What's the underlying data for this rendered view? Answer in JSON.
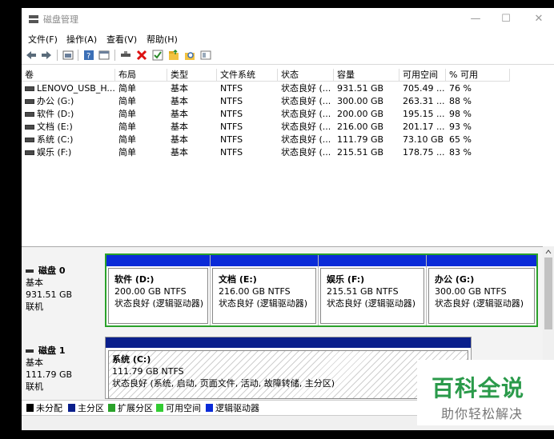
{
  "window": {
    "title": "磁盘管理",
    "minimize": "—",
    "maximize": "☐",
    "close": "✕"
  },
  "menu": [
    "文件(F)",
    "操作(A)",
    "查看(V)",
    "帮助(H)"
  ],
  "columns": [
    "卷",
    "布局",
    "类型",
    "文件系统",
    "状态",
    "容量",
    "可用空间",
    "% 可用"
  ],
  "volumes": [
    [
      "LENOVO_USB_H...",
      "简单",
      "基本",
      "NTFS",
      "状态良好 (...",
      "931.51 GB",
      "705.49 ...",
      "76 %"
    ],
    [
      "办公 (G:)",
      "简单",
      "基本",
      "NTFS",
      "状态良好 (...",
      "300.00 GB",
      "263.31 ...",
      "88 %"
    ],
    [
      "软件 (D:)",
      "简单",
      "基本",
      "NTFS",
      "状态良好 (...",
      "200.00 GB",
      "195.15 ...",
      "98 %"
    ],
    [
      "文档 (E:)",
      "简单",
      "基本",
      "NTFS",
      "状态良好 (...",
      "216.00 GB",
      "201.17 ...",
      "93 %"
    ],
    [
      "系统 (C:)",
      "简单",
      "基本",
      "NTFS",
      "状态良好 (...",
      "111.79 GB",
      "73.10 GB",
      "65 %"
    ],
    [
      "娱乐 (F:)",
      "简单",
      "基本",
      "NTFS",
      "状态良好 (...",
      "215.51 GB",
      "178.75 ...",
      "83 %"
    ]
  ],
  "disk0": {
    "name": "磁盘 0",
    "type": "基本",
    "size": "931.51 GB",
    "status": "联机",
    "partitions": [
      {
        "name": "软件  (D:)",
        "size": "200.00 GB NTFS",
        "status": "状态良好 (逻辑驱动器)"
      },
      {
        "name": "文档  (E:)",
        "size": "216.00 GB NTFS",
        "status": "状态良好 (逻辑驱动器)"
      },
      {
        "name": "娱乐  (F:)",
        "size": "215.51 GB NTFS",
        "status": "状态良好 (逻辑驱动器)"
      },
      {
        "name": "办公  (G:)",
        "size": "300.00 GB NTFS",
        "status": "状态良好 (逻辑驱动器)"
      }
    ]
  },
  "disk1": {
    "name": "磁盘 1",
    "type": "基本",
    "size": "111.79 GB",
    "status": "联机",
    "partition": {
      "name": "系统  (C:)",
      "size": "111.79 GB NTFS",
      "status": "状态良好 (系统, 启动, 页面文件, 活动, 故障转储, 主分区)"
    }
  },
  "legend": [
    {
      "label": "未分配",
      "color": "#000000"
    },
    {
      "label": "主分区",
      "color": "#0a1f8c"
    },
    {
      "label": "扩展分区",
      "color": "#2aa22a"
    },
    {
      "label": "可用空间",
      "color": "#33cc33"
    },
    {
      "label": "逻辑驱动器",
      "color": "#0a2bd8"
    }
  ],
  "watermark": {
    "line1": "百科全说",
    "line2": "助你轻松解决"
  },
  "icons": [
    "back-icon",
    "forward-icon",
    "properties-icon",
    "help-icon",
    "view-icon",
    "connect-icon",
    "delete-icon",
    "check-icon",
    "folder-icon",
    "search-icon",
    "panel-icon"
  ]
}
